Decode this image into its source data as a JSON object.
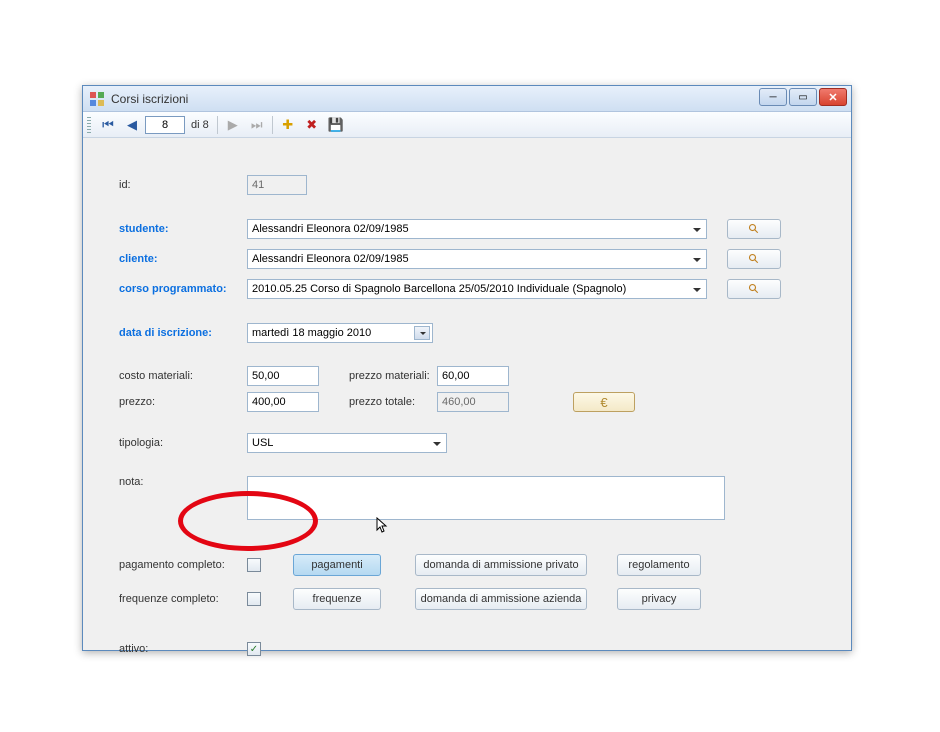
{
  "window": {
    "title": "Corsi iscrizioni"
  },
  "nav": {
    "position": "8",
    "of": "di 8"
  },
  "labels": {
    "id": "id:",
    "studente": "studente:",
    "cliente": "cliente:",
    "corso": "corso programmato:",
    "data": "data di iscrizione:",
    "costoMateriali": "costo materiali:",
    "prezzoMateriali": "prezzo materiali:",
    "prezzo": "prezzo:",
    "prezzoTotale": "prezzo totale:",
    "tipologia": "tipologia:",
    "nota": "nota:",
    "pagCompleto": "pagamento completo:",
    "freqCompleto": "frequenze completo:",
    "attivo": "attivo:"
  },
  "values": {
    "id": "41",
    "studente": "Alessandri Eleonora 02/09/1985",
    "cliente": "Alessandri Eleonora 02/09/1985",
    "corso": "2010.05.25 Corso di Spagnolo Barcellona 25/05/2010 Individuale (Spagnolo)",
    "data": "martedì  18   maggio   2010",
    "costoMateriali": "50,00",
    "prezzoMateriali": "60,00",
    "prezzo": "400,00",
    "prezzoTotale": "460,00",
    "tipologia": "USL",
    "attivoChecked": "✓"
  },
  "buttons": {
    "pagamenti": "pagamenti",
    "frequenze": "frequenze",
    "domandaPrivato": "domanda di ammissione privato",
    "domandaAzienda": "domanda di ammissione azienda",
    "regolamento": "regolamento",
    "privacy": "privacy",
    "euro": "€"
  }
}
